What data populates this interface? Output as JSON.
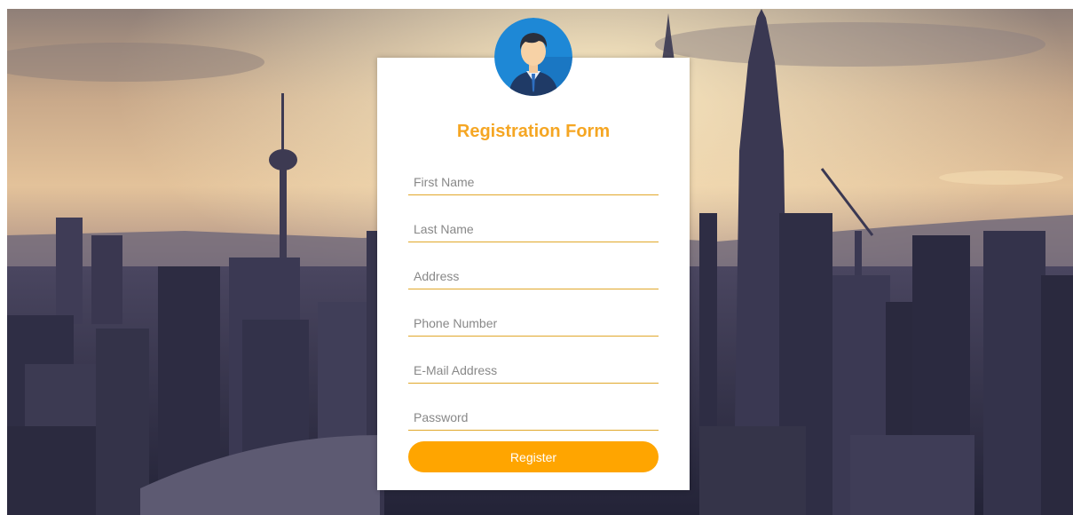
{
  "form": {
    "title": "Registration Form",
    "fields": [
      {
        "name": "first-name-field",
        "placeholder": "First Name",
        "value": ""
      },
      {
        "name": "last-name-field",
        "placeholder": "Last Name",
        "value": ""
      },
      {
        "name": "address-field",
        "placeholder": "Address",
        "value": ""
      },
      {
        "name": "phone-number-field",
        "placeholder": "Phone Number",
        "value": ""
      },
      {
        "name": "email-field",
        "placeholder": "E-Mail Address",
        "value": ""
      },
      {
        "name": "password-field",
        "placeholder": "Password",
        "value": ""
      }
    ],
    "register_label": "Register"
  },
  "avatar": {
    "icon": "user-avatar-icon"
  },
  "colors": {
    "accent": "#ffa500",
    "title": "#f5a623",
    "underline": "#e1a82b",
    "avatar_bg": "#1e88d6"
  }
}
